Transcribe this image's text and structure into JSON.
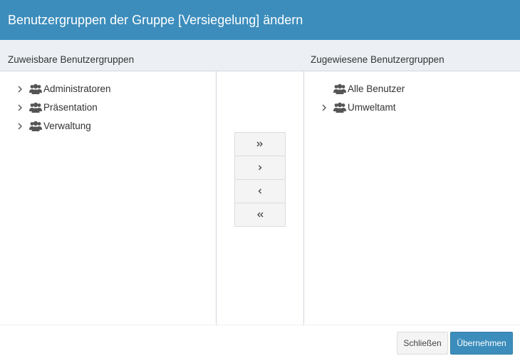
{
  "dialog": {
    "title": "Benutzergruppen der Gruppe [Versiegelung] ändern"
  },
  "available": {
    "header": "Zuweisbare Benutzergruppen",
    "items": [
      {
        "label": "Administratoren",
        "expandable": true,
        "icon": "users-icon"
      },
      {
        "label": "Präsentation",
        "expandable": true,
        "icon": "users-icon"
      },
      {
        "label": "Verwaltung",
        "expandable": true,
        "icon": "users-icon"
      }
    ]
  },
  "assigned": {
    "header": "Zugewiesene Benutzergruppen",
    "items": [
      {
        "label": "Alle Benutzer",
        "expandable": false,
        "icon": "users-icon"
      },
      {
        "label": "Umweltamt",
        "expandable": true,
        "icon": "users-icon"
      }
    ]
  },
  "transfer": {
    "add_all": "»",
    "add_selected": "›",
    "remove_selected": "‹",
    "remove_all": "«"
  },
  "footer": {
    "close_label": "Schließen",
    "apply_label": "Übernehmen"
  },
  "colors": {
    "accent": "#3c8dbc",
    "header_bg": "#ecf0f5",
    "icon": "#555555"
  }
}
